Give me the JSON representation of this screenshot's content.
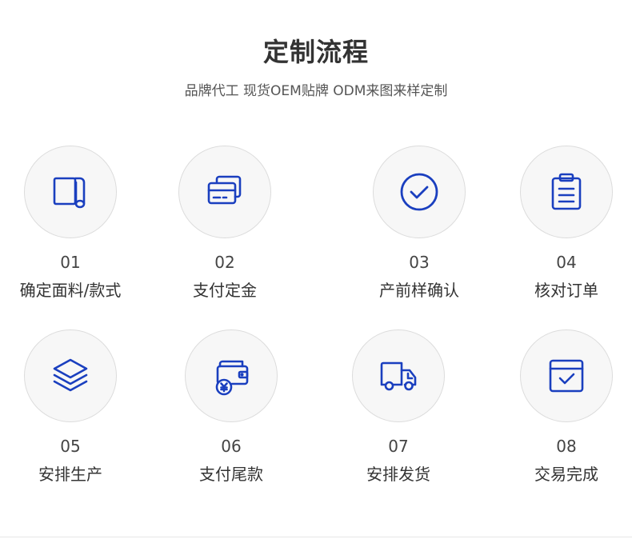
{
  "header": {
    "title": "定制流程",
    "subtitle": "品牌代工 现货OEM贴牌 ODM来图来样定制"
  },
  "accent_color": "#1a3fbf",
  "steps": [
    {
      "num": "01",
      "label": "确定面料/款式",
      "icon": "fabric-roll-icon"
    },
    {
      "num": "02",
      "label": "支付定金",
      "icon": "payment-cards-icon"
    },
    {
      "num": "03",
      "label": "产前样确认",
      "icon": "check-circle-icon"
    },
    {
      "num": "04",
      "label": "核对订单",
      "icon": "clipboard-icon"
    },
    {
      "num": "05",
      "label": "安排生产",
      "icon": "layers-icon"
    },
    {
      "num": "06",
      "label": "支付尾款",
      "icon": "wallet-yuan-icon"
    },
    {
      "num": "07",
      "label": "安排发货",
      "icon": "delivery-truck-icon"
    },
    {
      "num": "08",
      "label": "交易完成",
      "icon": "calendar-check-icon"
    }
  ]
}
